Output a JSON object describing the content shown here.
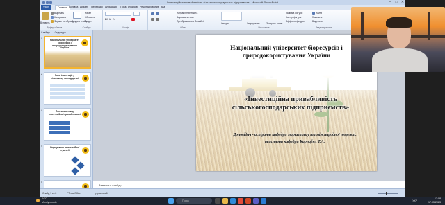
{
  "window": {
    "title": "Інвестиційна привабливість сільськогосподарських підприємств - Microsoft PowerPoint",
    "min": "–",
    "max": "□",
    "close": "✕"
  },
  "ribbon_tabs": [
    {
      "label": "Файл",
      "kind": "file"
    },
    {
      "label": "Главная",
      "kind": "active"
    },
    {
      "label": "Вставка",
      "kind": "normal"
    },
    {
      "label": "Дизайн",
      "kind": "normal"
    },
    {
      "label": "Переходы",
      "kind": "normal"
    },
    {
      "label": "Анимация",
      "kind": "normal"
    },
    {
      "label": "Показ слайдов",
      "kind": "normal"
    },
    {
      "label": "Рецензирование",
      "kind": "normal"
    },
    {
      "label": "Вид",
      "kind": "normal"
    }
  ],
  "ribbon": {
    "clipboard": {
      "paste": "Вставить",
      "cut": "Вырезать",
      "copy": "Копировать",
      "format": "Формат по образцу",
      "group": "Буфер обмена"
    },
    "slides": {
      "new": "Создать слайд",
      "layout": "Макет",
      "reset": "Сбросить",
      "section": "Раздел",
      "group": "Слайды"
    },
    "font": {
      "name": "",
      "size": "",
      "group": "Шрифт"
    },
    "paragraph": {
      "group": "Абзац",
      "dir": "Направление текста",
      "align": "Выровнять текст",
      "smartart": "Преобразовать в SmartArt"
    },
    "drawing": {
      "shapes": "Фигуры",
      "arrange": "Упорядочить",
      "styles": "Экспресс-стили",
      "fill": "Заливка фигуры",
      "outline": "Контур фигуры",
      "effects": "Эффекты фигуры",
      "group": "Рисование"
    },
    "editing": {
      "find": "Найти",
      "replace": "Заменить",
      "select": "Выделить",
      "group": "Редактирование"
    }
  },
  "left_pane": {
    "tabs": [
      "Слайды",
      "Структура"
    ],
    "thumbnails": [
      {
        "num": "1",
        "title": "Національний університет біоресурсів і природокористування України",
        "selected": true
      },
      {
        "num": "2",
        "title": "Роль інвестицій у сільському господарстві",
        "selected": false
      },
      {
        "num": "3",
        "title": "Показники стану інвестиційної привабливості",
        "selected": false
      },
      {
        "num": "4",
        "title": "Формування інвестиційної стратегії",
        "selected": false
      },
      {
        "num": "5",
        "title": "",
        "selected": false
      }
    ]
  },
  "slide": {
    "title": "Національний університет біоресурсів і природокористування України",
    "subtitle": "«Інвестиційна привабливість сільськогосподарських підприємств»",
    "author": "Доповідач - аспірант кафедри маркетингу та міжнародної торгівлі, асистент кафедри Карнаўнх Т.А."
  },
  "notes": {
    "placeholder": "Заметки к слайду"
  },
  "status": {
    "slide": "Слайд 1 из 8",
    "theme": "\"Тема Office\"",
    "lang": "украинский",
    "zoom_pct": 45
  },
  "taskbar": {
    "temp": "24°C",
    "weather": "Mostly cloudy",
    "search": "Поиск",
    "lang": "УКР",
    "time": "12:08",
    "date": "17.05.2023"
  },
  "colors": {
    "accent": "#2c5ca8",
    "selection": "#f3b430",
    "taskbar": "#1e2430"
  },
  "icons": [
    "windows-icon",
    "search-icon",
    "file-explorer-icon",
    "edge-icon",
    "chrome-icon",
    "powerpoint-icon",
    "teams-icon",
    "wifi-icon",
    "volume-icon"
  ]
}
